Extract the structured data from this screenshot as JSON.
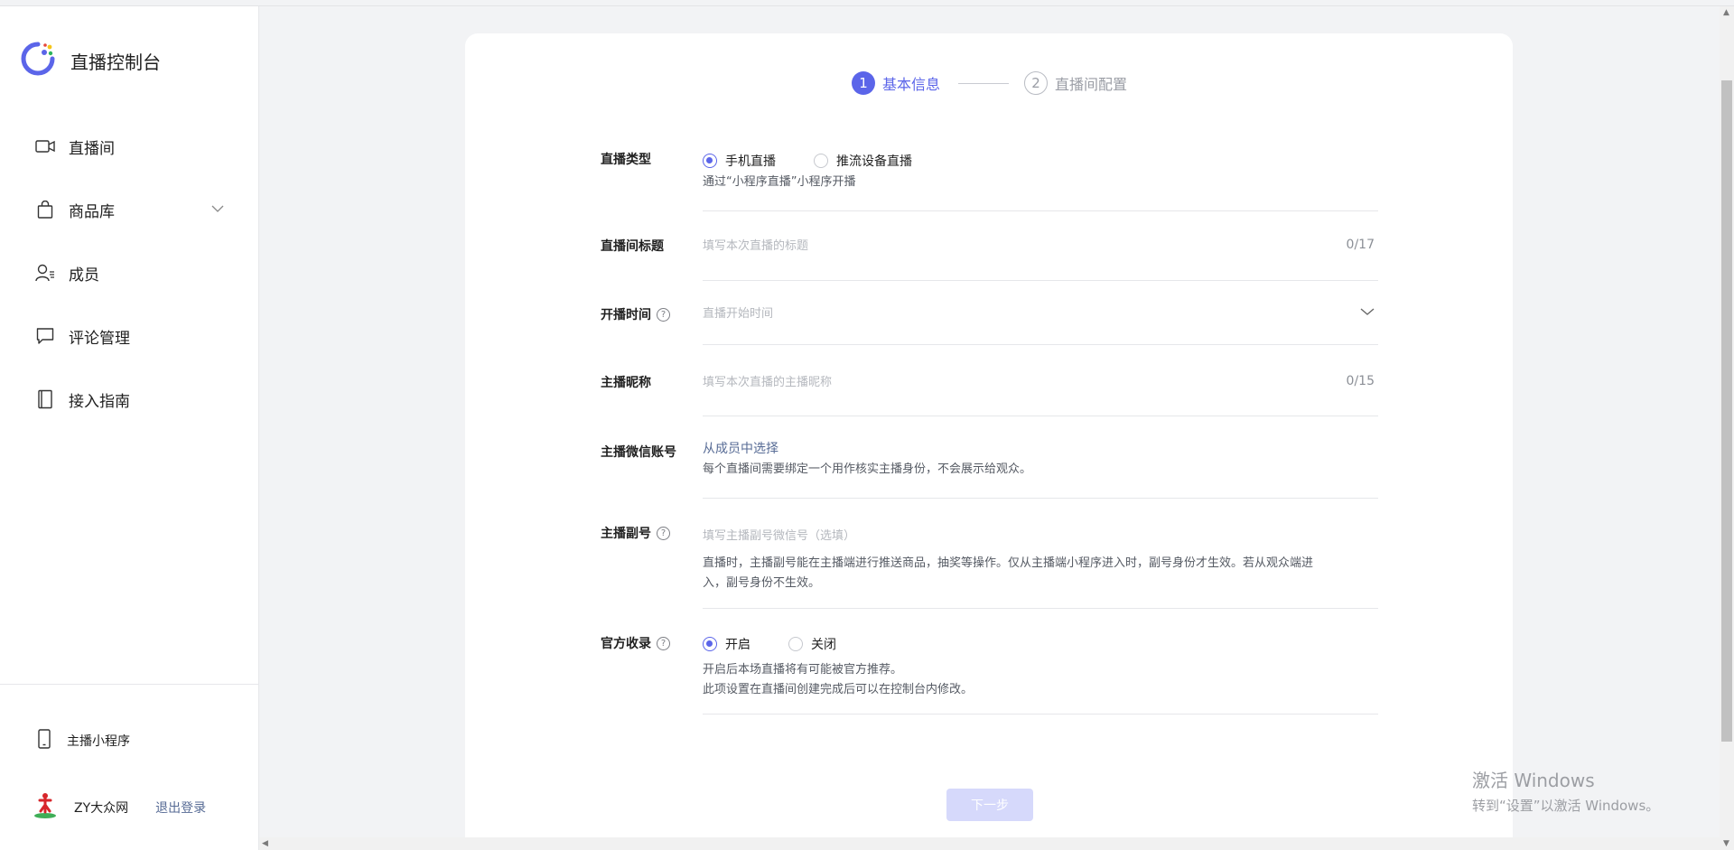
{
  "sidebar": {
    "title": "直播控制台",
    "nav": [
      {
        "label": "直播间",
        "icon": "video-camera-icon"
      },
      {
        "label": "商品库",
        "icon": "shopping-bag-icon",
        "expandable": true
      },
      {
        "label": "成员",
        "icon": "member-icon"
      },
      {
        "label": "评论管理",
        "icon": "comment-icon"
      },
      {
        "label": "接入指南",
        "icon": "book-icon"
      }
    ],
    "mini_program": "主播小程序",
    "user_name": "ZY大众网",
    "logout": "退出登录"
  },
  "steps": [
    {
      "num": "1",
      "label": "基本信息",
      "active": true
    },
    {
      "num": "2",
      "label": "直播间配置",
      "active": false
    }
  ],
  "form": {
    "live_type": {
      "label": "直播类型",
      "options": [
        "手机直播",
        "推流设备直播"
      ],
      "selected": "手机直播",
      "hint": "通过“小程序直播”小程序开播"
    },
    "room_title": {
      "label": "直播间标题",
      "placeholder": "填写本次直播的标题",
      "counter": "0/17"
    },
    "start_time": {
      "label": "开播时间",
      "placeholder": "直播开始时间"
    },
    "anchor_nickname": {
      "label": "主播昵称",
      "placeholder": "填写本次直播的主播昵称",
      "counter": "0/15"
    },
    "anchor_wechat": {
      "label": "主播微信账号",
      "link": "从成员中选择",
      "hint": "每个直播间需要绑定一个用作核实主播身份，不会展示给观众。"
    },
    "sub_anchor": {
      "label": "主播副号",
      "placeholder": "填写主播副号微信号（选填）",
      "hint_line1": "直播时，主播副号能在主播端进行推送商品，抽奖等操作。仅从主播端小程序进入时，副号身份才生效。若从观众端进",
      "hint_line2": "入，副号身份不生效。"
    },
    "official_index": {
      "label": "官方收录",
      "options": [
        "开启",
        "关闭"
      ],
      "selected": "开启",
      "hint_line1": "开启后本场直播将有可能被官方推荐。",
      "hint_line2": "此项设置在直播间创建完成后可以在控制台内修改。"
    }
  },
  "next_button": "下一步",
  "watermark": {
    "line1": "激活 Windows",
    "line2": "转到“设置”以激活 Windows。"
  },
  "colors": {
    "accent": "#5b65e9",
    "link": "#576b95",
    "disabled_button": "#d6d9fb"
  }
}
